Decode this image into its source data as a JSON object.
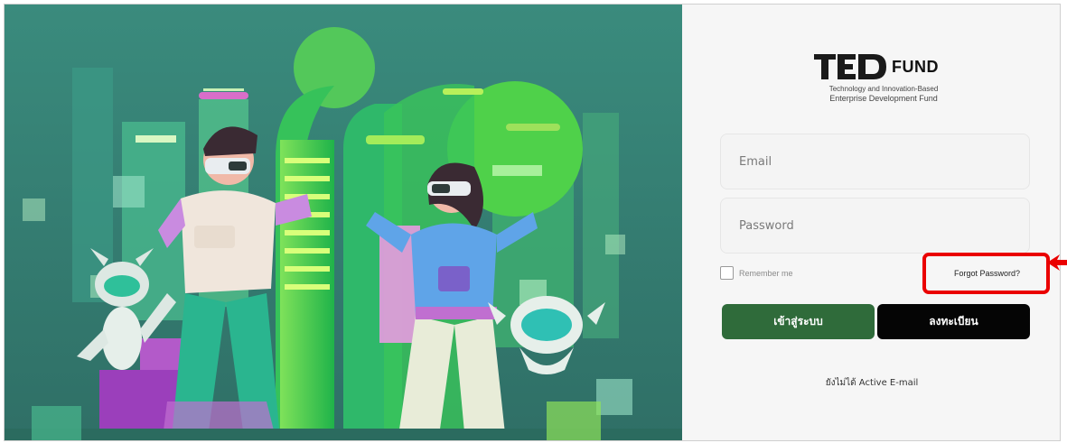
{
  "brand": {
    "wordmark": "FUND",
    "tagline_line1": "Technology and Innovation-Based",
    "tagline_line2": "Enterprise Development Fund"
  },
  "form": {
    "email_placeholder": "Email",
    "email_value": "",
    "password_placeholder": "Password",
    "password_value": "",
    "remember_label": "Remember me",
    "remember_checked": false,
    "forgot_label": "Forgot Password?",
    "login_label": "เข้าสู่ระบบ",
    "register_label": "ลงทะเบียน",
    "not_active_label": "ยังไม่ได้ Active E-mail"
  },
  "annotation": {
    "highlight_color": "#ea0000",
    "target": "forgot-password-link"
  },
  "colors": {
    "login_button": "#2f6b3a",
    "register_button": "#050505",
    "hero_bg": "#3f8a7c"
  }
}
